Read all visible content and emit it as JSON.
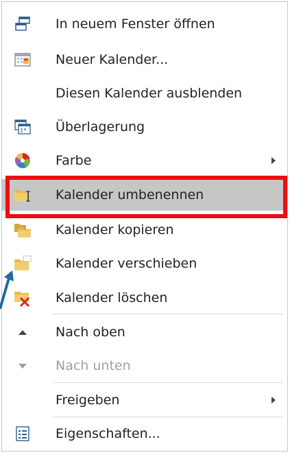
{
  "menu": {
    "items": [
      {
        "label": "In neuem Fenster öffnen",
        "icon": "new-window-icon"
      },
      {
        "label": "Neuer Kalender...",
        "icon": "new-calendar-icon"
      },
      {
        "label": "Diesen Kalender ausblenden",
        "icon": ""
      },
      {
        "label": "Überlagerung",
        "icon": "overlay-icon"
      },
      {
        "label": "Farbe",
        "icon": "color-palette-icon",
        "submenu": true
      },
      {
        "label": "Kalender umbenennen",
        "icon": "rename-folder-icon",
        "highlighted": true
      },
      {
        "label": "Kalender kopieren",
        "icon": "copy-folder-icon"
      },
      {
        "label": "Kalender verschieben",
        "icon": "move-folder-icon"
      },
      {
        "label": "Kalender löschen",
        "icon": "delete-folder-icon"
      },
      {
        "label": "Nach oben",
        "icon": "move-up-icon"
      },
      {
        "label": "Nach unten",
        "icon": "move-down-icon",
        "disabled": true
      },
      {
        "label": "Freigeben",
        "icon": "",
        "submenu": true
      },
      {
        "label": "Eigenschaften...",
        "icon": "properties-icon"
      }
    ]
  },
  "colors": {
    "highlight_border": "#ea0f12",
    "hover_bg": "#c6c6c6",
    "folder": "#e9b94e",
    "delete": "#d6282b",
    "arrow_overlay": "#1e6aa7"
  }
}
